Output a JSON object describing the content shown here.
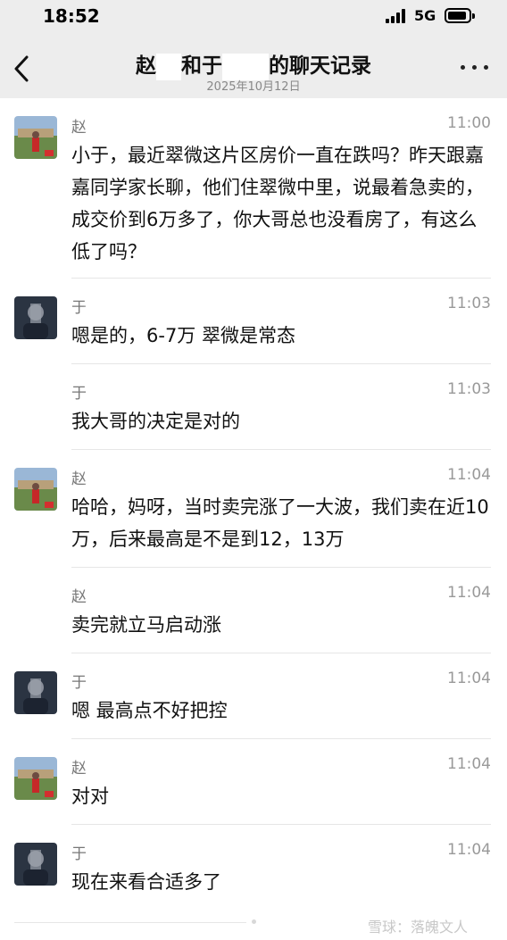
{
  "status": {
    "time": "18:52",
    "network": "5G"
  },
  "header": {
    "title_part1": "赵",
    "title_part2": "和于",
    "title_part3": "的聊天记录",
    "date": "2025年10月12日"
  },
  "messages": [
    {
      "sender": "赵",
      "time": "11:00",
      "avatar": "landscape-avatar",
      "text": "小于，最近翠微这片区房价一直在跌吗？昨天跟嘉嘉同学家长聊，他们住翠微中里，说最着急卖的，成交价到6万多了，你大哥总也没看房了，有这么低了吗？"
    },
    {
      "sender": "于",
      "time": "11:03",
      "avatar": "person-avatar",
      "text": "嗯是的，6-7万 翠微是常态"
    },
    {
      "sender": "于",
      "time": "11:03",
      "avatar": "",
      "text": "我大哥的决定是对的"
    },
    {
      "sender": "赵",
      "time": "11:04",
      "avatar": "landscape-avatar",
      "text": "哈哈，妈呀，当时卖完涨了一大波，我们卖在近10万，后来最高是不是到12，13万"
    },
    {
      "sender": "赵",
      "time": "11:04",
      "avatar": "",
      "text": "卖完就立马启动涨"
    },
    {
      "sender": "于",
      "time": "11:04",
      "avatar": "person-avatar",
      "text": "嗯 最高点不好把控"
    },
    {
      "sender": "赵",
      "time": "11:04",
      "avatar": "landscape-avatar",
      "text": "对对"
    },
    {
      "sender": "于",
      "time": "11:04",
      "avatar": "person-avatar",
      "text": "现在来看合适多了"
    }
  ],
  "watermark": "雪球：落魄文人",
  "colors": {
    "header_bg": "#ededed",
    "divider": "#e6e6e6",
    "meta_text": "#999999"
  }
}
